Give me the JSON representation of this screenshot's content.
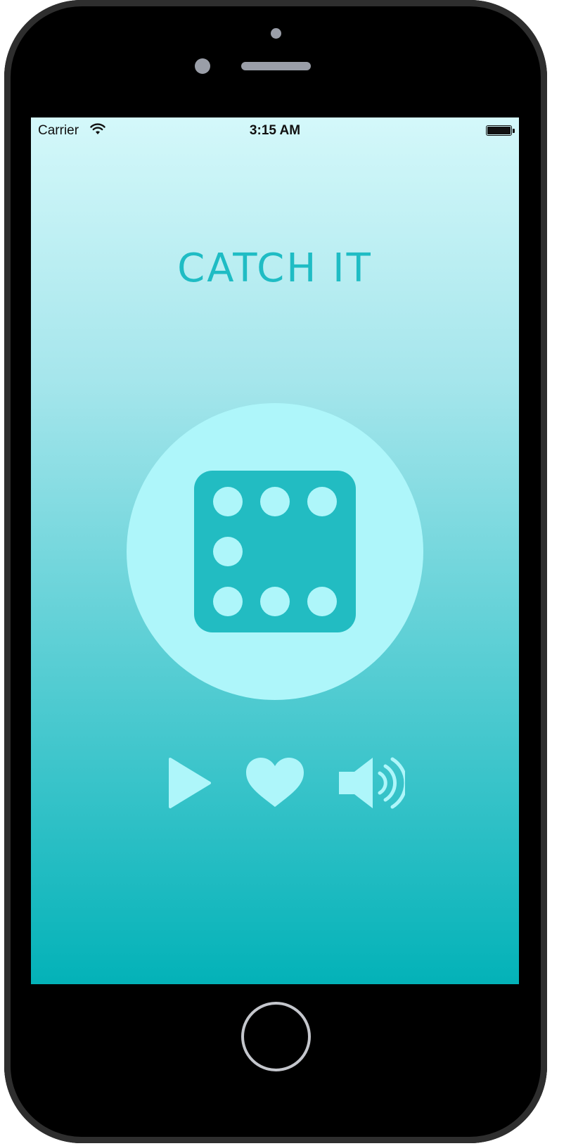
{
  "status_bar": {
    "carrier": "Carrier",
    "time": "3:15 AM",
    "wifi_icon": "wifi-icon",
    "battery_icon": "battery-full-icon"
  },
  "app": {
    "title": "CATCH IT",
    "main_icon": "dice-icon",
    "accent_color": "#1fbcc4",
    "light_color": "#aef6fa"
  },
  "controls": [
    {
      "name": "play",
      "icon": "play-icon"
    },
    {
      "name": "like",
      "icon": "heart-icon"
    },
    {
      "name": "sound",
      "icon": "speaker-icon"
    }
  ]
}
